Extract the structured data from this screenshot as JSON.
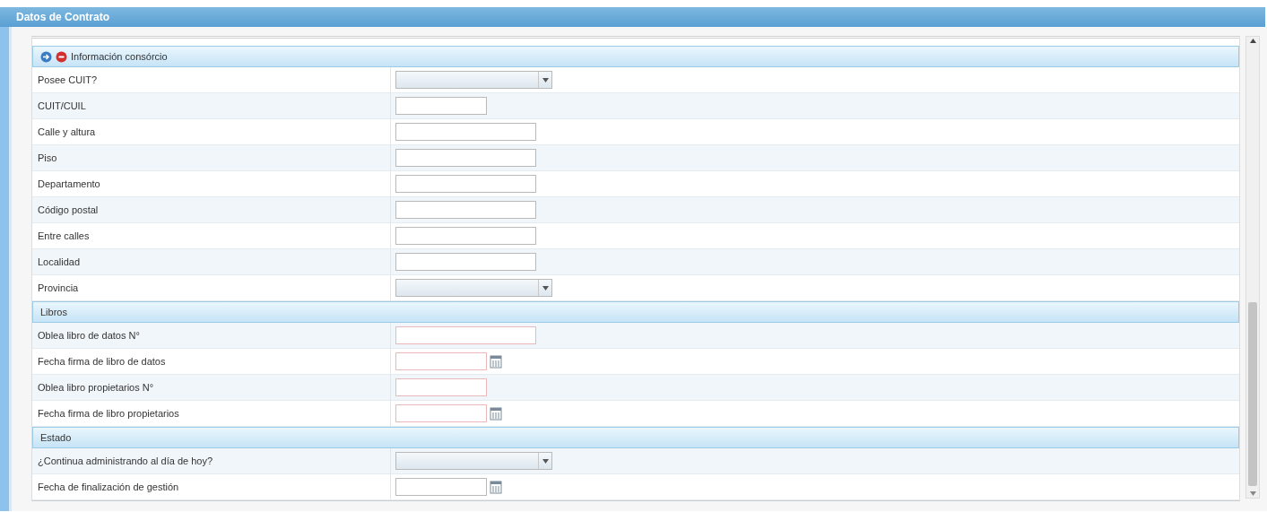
{
  "window": {
    "title": "Datos de Contrato"
  },
  "sections": [
    {
      "kind": "panel",
      "title": "Información consórcio",
      "fields": [
        {
          "label": "Posee CUIT?",
          "kind": "select"
        },
        {
          "label": "CUIT/CUIL",
          "kind": "short-text",
          "required": false
        },
        {
          "label": "Calle y altura",
          "kind": "text",
          "required": false
        },
        {
          "label": "Piso",
          "kind": "text",
          "required": false
        },
        {
          "label": "Departamento",
          "kind": "text",
          "required": false
        },
        {
          "label": "Código postal",
          "kind": "text",
          "required": false
        },
        {
          "label": "Entre calles",
          "kind": "text",
          "required": false
        },
        {
          "label": "Localidad",
          "kind": "text",
          "required": false
        },
        {
          "label": "Provincia",
          "kind": "select"
        }
      ]
    },
    {
      "kind": "band",
      "title": "Libros",
      "fields": [
        {
          "label": "Oblea libro de datos N°",
          "kind": "text",
          "required": true
        },
        {
          "label": "Fecha firma de libro de datos",
          "kind": "date",
          "required": true
        },
        {
          "label": "Oblea libro propietarios N°",
          "kind": "short-text",
          "required": true
        },
        {
          "label": "Fecha firma de libro propietarios",
          "kind": "date",
          "required": true
        }
      ]
    },
    {
      "kind": "band",
      "title": "Estado",
      "fields": [
        {
          "label": "¿Continua administrando al día de hoy?",
          "kind": "select"
        },
        {
          "label": "Fecha de finalización de gestión",
          "kind": "date",
          "required": false
        }
      ]
    }
  ]
}
